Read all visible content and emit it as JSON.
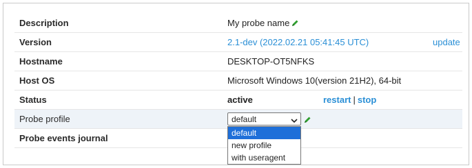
{
  "rows": [
    {
      "label": "Description",
      "value": "My probe name"
    },
    {
      "label": "Version",
      "value": "2.1-dev (2022.02.21 05:41:45 UTC)",
      "action": "update"
    },
    {
      "label": "Hostname",
      "value": "DESKTOP-OT5NFKS"
    },
    {
      "label": "Host OS",
      "value": "Microsoft Windows 10(version 21H2), 64-bit"
    },
    {
      "label": "Status",
      "value": "active",
      "actions": [
        "restart",
        "stop"
      ],
      "separator": "|"
    },
    {
      "label": "Probe profile"
    },
    {
      "label": "Probe events journal"
    }
  ],
  "profile_select": {
    "selected": "default",
    "options": [
      "default",
      "new profile",
      "with useragent"
    ]
  },
  "colors": {
    "link": "#2a8fd6",
    "highlight_row": "#eef3f8",
    "pencil": "#2e9e2e",
    "option_selected": "#1e6fd9"
  },
  "icons": {
    "edit": "pencil-icon",
    "dropdown": "chevron-down-icon"
  }
}
